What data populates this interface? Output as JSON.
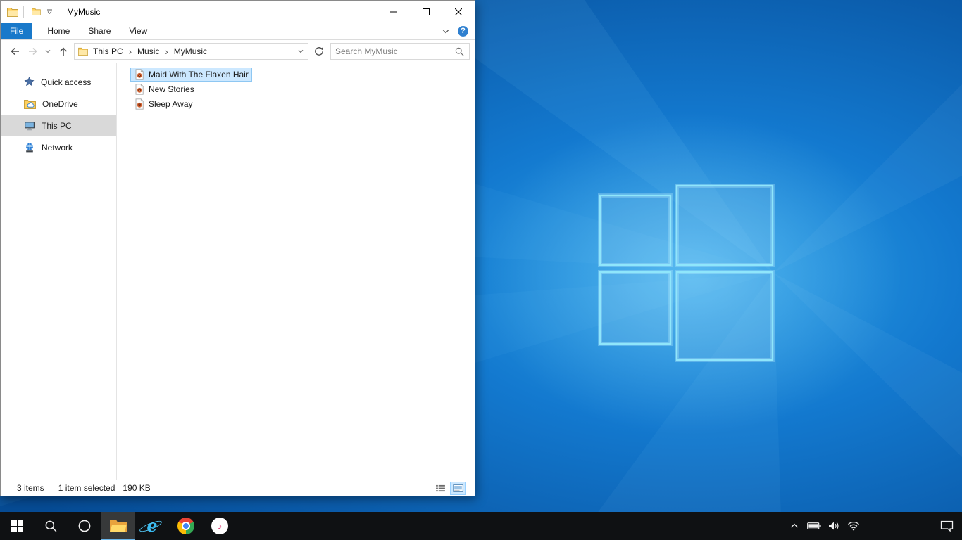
{
  "window": {
    "title": "MyMusic",
    "ribbon": {
      "tabs": [
        {
          "label": "File"
        },
        {
          "label": "Home"
        },
        {
          "label": "Share"
        },
        {
          "label": "View"
        }
      ]
    },
    "address": {
      "crumbs": [
        {
          "label": "This PC"
        },
        {
          "label": "Music"
        },
        {
          "label": "MyMusic"
        }
      ]
    },
    "search": {
      "placeholder": "Search MyMusic"
    },
    "sidebar": {
      "items": [
        {
          "label": "Quick access",
          "icon": "quick-access-star-icon",
          "selected": false
        },
        {
          "label": "OneDrive",
          "icon": "onedrive-icon",
          "selected": false
        },
        {
          "label": "This PC",
          "icon": "this-pc-icon",
          "selected": true
        },
        {
          "label": "Network",
          "icon": "network-icon",
          "selected": false
        }
      ]
    },
    "files": [
      {
        "name": "Maid With The Flaxen Hair",
        "icon": "music-file-icon",
        "selected": true
      },
      {
        "name": "New Stories",
        "icon": "music-file-icon",
        "selected": false
      },
      {
        "name": "Sleep Away",
        "icon": "music-file-icon",
        "selected": false
      }
    ],
    "status": {
      "count": "3 items",
      "selection": "1 item selected",
      "size": "190 KB"
    }
  },
  "icons": {
    "help_glyph": "?",
    "breadcrumb_sep": "›",
    "music_note": "♪",
    "ie_letter": "e"
  },
  "taskbar": {
    "pinned": [
      {
        "name": "start"
      },
      {
        "name": "search"
      },
      {
        "name": "cortana"
      },
      {
        "name": "file-explorer",
        "active": true
      },
      {
        "name": "internet-explorer"
      },
      {
        "name": "chrome"
      },
      {
        "name": "itunes"
      }
    ],
    "tray": [
      {
        "name": "hidden-icons-chevron"
      },
      {
        "name": "battery"
      },
      {
        "name": "volume"
      },
      {
        "name": "wifi"
      },
      {
        "name": "action-center"
      }
    ]
  },
  "colors": {
    "accent_blue": "#1979ca",
    "selection_bg": "#cce8ff",
    "selection_border": "#99d1ff",
    "sidebar_selected": "#d9d9d9",
    "taskbar_bg": "#0f1113",
    "wallpaper_deep": "#064b94",
    "wallpaper_bright": "#2ea3e8"
  }
}
